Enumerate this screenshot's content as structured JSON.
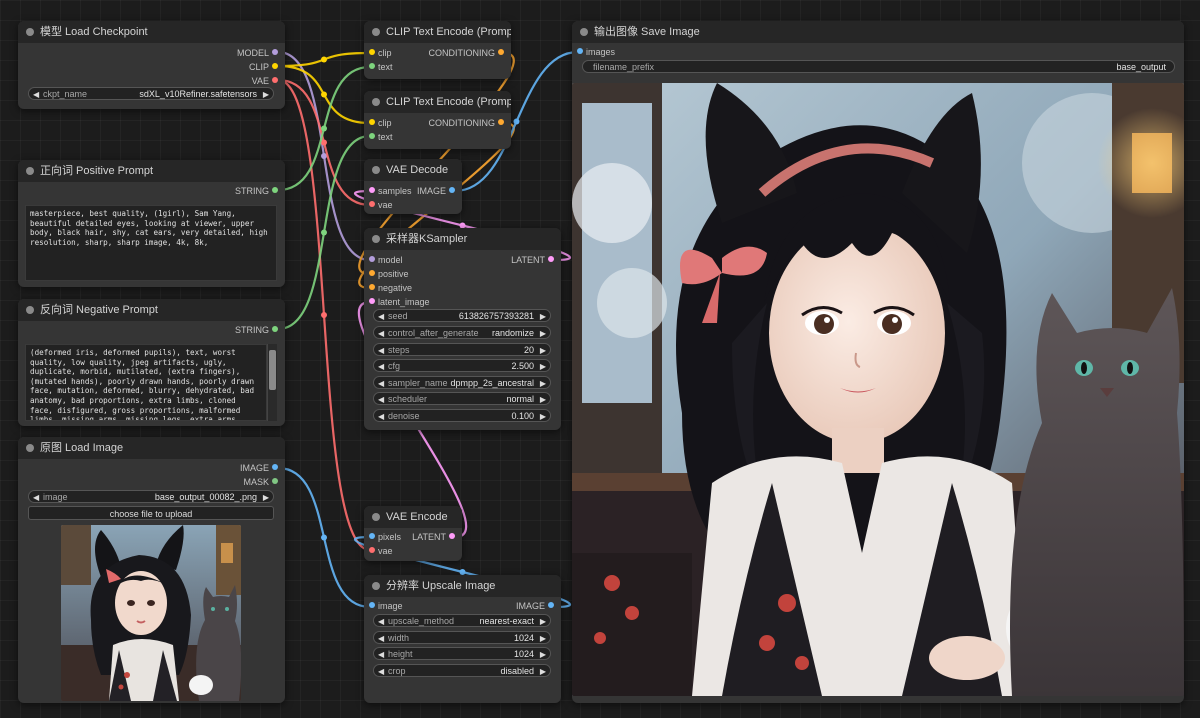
{
  "colors": {
    "model": "#b39ddb",
    "clip": "#ffd500",
    "vae": "#ff6e6e",
    "conditioning": "#ffa931",
    "latent": "#ff9cf9",
    "image": "#64b5f6",
    "string": "#7ed47e",
    "mask": "#81c784",
    "mid_grey": "#8a8a8a"
  },
  "nodes": {
    "checkpoint": {
      "title": "模型 Load Checkpoint",
      "outputs": [
        "MODEL",
        "CLIP",
        "VAE"
      ],
      "ckpt": {
        "label": "ckpt_name",
        "value": "sdXL_v10Refiner.safetensors"
      }
    },
    "positive": {
      "title": "正向词 Positive Prompt",
      "output": "STRING",
      "text": "masterpiece, best quality, (1girl), Sam Yang, beautiful detailed eyes, looking at viewer, upper body, black hair, shy, cat ears, very detailed, high resolution, sharp, sharp image, 4k, 8k,"
    },
    "negative": {
      "title": "反向词 Negative Prompt",
      "output": "STRING",
      "text": "(deformed iris, deformed pupils), text, worst quality, low quality, jpeg artifacts, ugly, duplicate, morbid, mutilated, (extra fingers), (mutated hands), poorly drawn hands, poorly drawn face, mutation, deformed, blurry, dehydrated, bad anatomy, bad proportions, extra limbs, cloned face, disfigured, gross proportions, malformed limbs, missing arms, missing legs, extra arms, extra legs, (fused fingers), (too many fingers), long"
    },
    "load_image": {
      "title": "原图 Load Image",
      "outputs": [
        "IMAGE",
        "MASK"
      ],
      "image": {
        "label": "image",
        "value": "base_output_00082_.png"
      },
      "upload_label": "choose file to upload"
    },
    "clip1": {
      "title": "CLIP Text Encode (Prompt)",
      "inputs": [
        "clip",
        "text"
      ],
      "output": "CONDITIONING"
    },
    "clip2": {
      "title": "CLIP Text Encode (Prompt)",
      "inputs": [
        "clip",
        "text"
      ],
      "output": "CONDITIONING"
    },
    "vae_decode": {
      "title": "VAE Decode",
      "inputs": [
        "samples",
        "vae"
      ],
      "output": "IMAGE"
    },
    "ksampler": {
      "title": "采样器KSampler",
      "inputs": [
        "model",
        "positive",
        "negative",
        "latent_image"
      ],
      "output": "LATENT",
      "widgets": [
        {
          "label": "seed",
          "value": "613826757393281"
        },
        {
          "label": "control_after_generate",
          "value": "randomize"
        },
        {
          "label": "steps",
          "value": "20"
        },
        {
          "label": "cfg",
          "value": "2.500"
        },
        {
          "label": "sampler_name",
          "value": "dpmpp_2s_ancestral"
        },
        {
          "label": "scheduler",
          "value": "normal"
        },
        {
          "label": "denoise",
          "value": "0.100"
        }
      ]
    },
    "vae_encode": {
      "title": "VAE Encode",
      "inputs": [
        "pixels",
        "vae"
      ],
      "output": "LATENT"
    },
    "upscale": {
      "title": "分辨率 Upscale Image",
      "input": "image",
      "output": "IMAGE",
      "widgets": [
        {
          "label": "upscale_method",
          "value": "nearest-exact"
        },
        {
          "label": "width",
          "value": "1024"
        },
        {
          "label": "height",
          "value": "1024"
        },
        {
          "label": "crop",
          "value": "disabled"
        }
      ]
    },
    "save": {
      "title": "输出图像 Save Image",
      "input": "images",
      "filename": {
        "label": "filename_prefix",
        "value": "base_output"
      }
    }
  }
}
